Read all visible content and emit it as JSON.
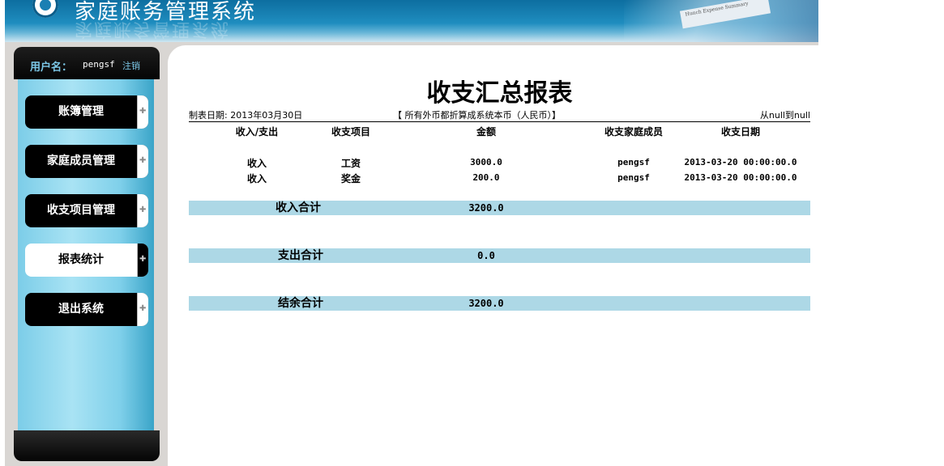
{
  "header": {
    "title": "家庭账务管理系统",
    "deco_text": "Hunch Expense Summary"
  },
  "user": {
    "label": "用户名：",
    "name": "pengsf",
    "logout": "注销"
  },
  "menu": [
    {
      "label": "账簿管理",
      "active": false
    },
    {
      "label": "家庭成员管理",
      "active": false
    },
    {
      "label": "收支项目管理",
      "active": false
    },
    {
      "label": "报表统计",
      "active": true
    },
    {
      "label": "退出系统",
      "active": false
    }
  ],
  "report": {
    "title": "收支汇总报表",
    "date": "制表日期: 2013年03月30日",
    "note": "【 所有外币都折算成系统本币（人民币）】",
    "range": "从null到null",
    "columns": [
      "收入/支出",
      "收支项目",
      "金额",
      "收支家庭成员",
      "收支日期"
    ],
    "rows": [
      [
        "收入",
        "工资",
        "3000.0",
        "pengsf",
        "2013-03-20 00:00:00.0"
      ],
      [
        "收入",
        "奖金",
        "200.0",
        "pengsf",
        "2013-03-20 00:00:00.0"
      ]
    ],
    "totals": [
      {
        "label": "收入合计",
        "value": "3200.0"
      },
      {
        "label": "支出合计",
        "value": "0.0"
      },
      {
        "label": "结余合计",
        "value": "3200.0"
      }
    ]
  }
}
